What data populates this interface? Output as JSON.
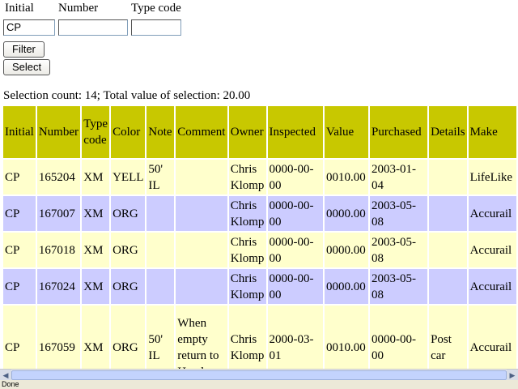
{
  "filter": {
    "initial_label": "Initial",
    "number_label": "Number",
    "type_code_label": "Type code",
    "initial_value": "CP",
    "number_value": "",
    "type_code_value": "",
    "filter_button": "Filter",
    "select_button": "Select"
  },
  "selection_info": "Selection count: 14; Total value of selection: 20.00",
  "table": {
    "headers": [
      "Initial",
      "Number",
      "Type code",
      "Color",
      "Note",
      "Comment",
      "Owner",
      "Inspected",
      "Value",
      "Purchased",
      "Details",
      "Make"
    ],
    "rows": [
      [
        "CP",
        "165204",
        "XM",
        "YELL",
        "50' IL",
        "",
        "Chris Klomp",
        "0000-00-00",
        "0010.00",
        "2003-01-04",
        "",
        "LifeLike"
      ],
      [
        "CP",
        "167007",
        "XM",
        "ORG",
        "",
        "",
        "Chris Klomp",
        "0000-00-00",
        "0000.00",
        "2003-05-08",
        "",
        "Accurail"
      ],
      [
        "CP",
        "167018",
        "XM",
        "ORG",
        "",
        "",
        "Chris Klomp",
        "0000-00-00",
        "0000.00",
        "2003-05-08",
        "",
        "Accurail"
      ],
      [
        "CP",
        "167024",
        "XM",
        "ORG",
        "",
        "",
        "Chris Klomp",
        "0000-00-00",
        "0000.00",
        "2003-05-08",
        "",
        "Accurail"
      ],
      [
        "CP",
        "167059",
        "XM",
        "ORG",
        "50' IL",
        "When empty return to Handover",
        "Chris Klomp",
        "2000-03-01",
        "0010.00",
        "0000-00-00",
        "Post car",
        "Accurail"
      ]
    ]
  },
  "status": "Done",
  "colors": {
    "header": "#c8c800",
    "row_odd": "#ffffcc",
    "row_even": "#ccccff"
  }
}
